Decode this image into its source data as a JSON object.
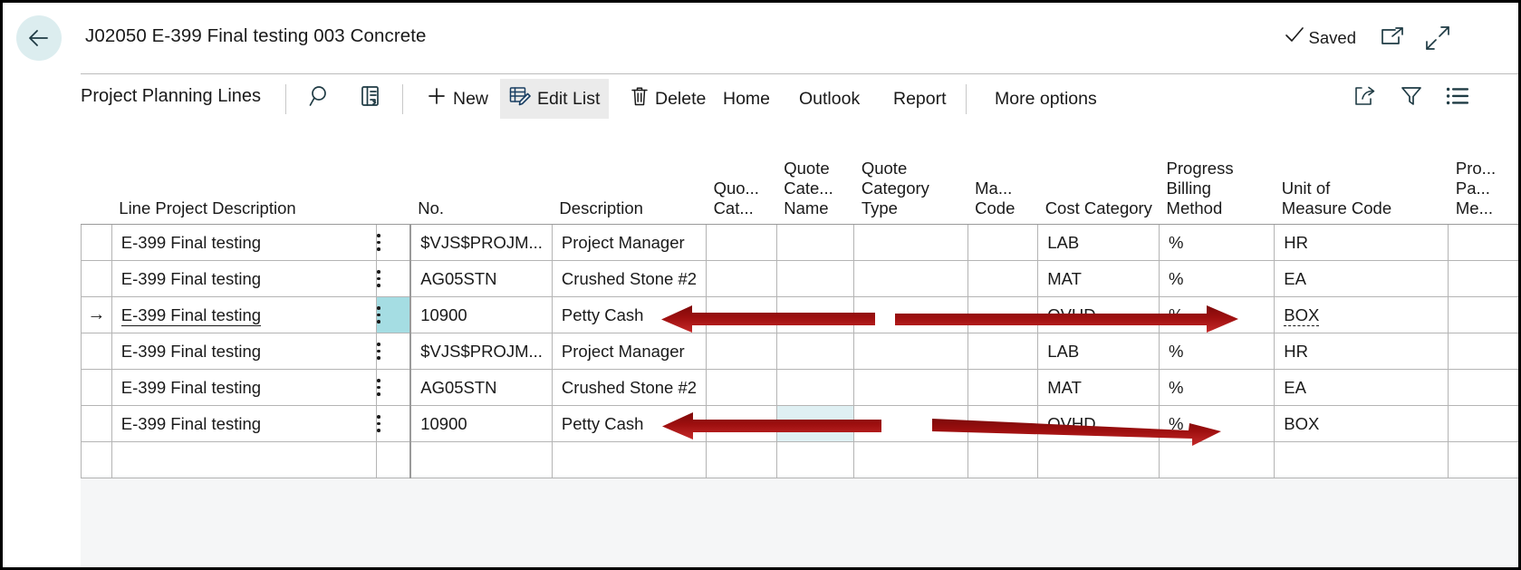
{
  "window": {
    "title": "J02050 E-399 Final testing 003 Concrete",
    "status": "Saved",
    "back_icon": "back-arrow-icon",
    "open_in_new_window_icon": "open-new-window-icon",
    "collapse_icon": "collapse-icon",
    "saved_check_icon": "check-icon"
  },
  "commandbar": {
    "title": "Project Planning Lines",
    "search_icon": "search-icon",
    "focus_icon": "focus-mode-icon",
    "new_label": "New",
    "new_icon": "plus-icon",
    "edit_list_label": "Edit List",
    "edit_list_icon": "edit-list-icon",
    "delete_label": "Delete",
    "delete_icon": "trash-icon",
    "home_label": "Home",
    "outlook_label": "Outlook",
    "report_label": "Report",
    "more_options_label": "More options",
    "share_icon": "share-icon",
    "filter_icon": "filter-icon",
    "list_icon": "list-view-icon"
  },
  "grid": {
    "columns": [
      {
        "id": "indicator",
        "header": ""
      },
      {
        "id": "line_project_description",
        "header": "Line Project Description"
      },
      {
        "id": "menu",
        "header": ""
      },
      {
        "id": "no",
        "header": "No."
      },
      {
        "id": "description",
        "header": "Description"
      },
      {
        "id": "quote_cat",
        "header": "Quo...\nCat..."
      },
      {
        "id": "quote_category_name",
        "header": "Quote\nCate...\nName"
      },
      {
        "id": "quote_category_type",
        "header": "Quote\nCategory\nType"
      },
      {
        "id": "ma_code",
        "header": "Ma...\nCode"
      },
      {
        "id": "cost_category",
        "header": "Cost Category"
      },
      {
        "id": "progress_billing_method",
        "header": "Progress\nBilling\nMethod"
      },
      {
        "id": "unit_of_measure_code",
        "header": "Unit of\nMeasure Code"
      },
      {
        "id": "progress_payment_method",
        "header": "Pro...\nPa...\nMe..."
      }
    ],
    "rows": [
      {
        "indicator": "",
        "line_project_description": "E-399 Final testing",
        "no": "$VJS$PROJM...",
        "description": "Project Manager",
        "quote_cat": "",
        "quote_category_name": "",
        "quote_category_type": "",
        "ma_code": "",
        "cost_category": "LAB",
        "progress_billing_method": "%",
        "unit_of_measure_code": "HR",
        "progress_payment_method": "",
        "selected": false
      },
      {
        "indicator": "",
        "line_project_description": "E-399 Final testing",
        "no": "AG05STN",
        "description": "Crushed Stone #2",
        "quote_cat": "",
        "quote_category_name": "",
        "quote_category_type": "",
        "ma_code": "",
        "cost_category": "MAT",
        "progress_billing_method": "%",
        "unit_of_measure_code": "EA",
        "progress_payment_method": "",
        "selected": false
      },
      {
        "indicator": "→",
        "line_project_description": "E-399 Final testing",
        "no": "10900",
        "description": "Petty Cash",
        "quote_cat": "",
        "quote_category_name": "",
        "quote_category_type": "",
        "ma_code": "",
        "cost_category": "OVHD",
        "progress_billing_method": "%",
        "unit_of_measure_code": "BOX",
        "progress_payment_method": "",
        "selected": true
      },
      {
        "indicator": "",
        "line_project_description": "E-399 Final testing",
        "no": "$VJS$PROJM...",
        "description": "Project Manager",
        "quote_cat": "",
        "quote_category_name": "",
        "quote_category_type": "",
        "ma_code": "",
        "cost_category": "LAB",
        "progress_billing_method": "%",
        "unit_of_measure_code": "HR",
        "progress_payment_method": "",
        "selected": false
      },
      {
        "indicator": "",
        "line_project_description": "E-399 Final testing",
        "no": "AG05STN",
        "description": "Crushed Stone #2",
        "quote_cat": "",
        "quote_category_name": "",
        "quote_category_type": "",
        "ma_code": "",
        "cost_category": "MAT",
        "progress_billing_method": "%",
        "unit_of_measure_code": "EA",
        "progress_payment_method": "",
        "selected": false
      },
      {
        "indicator": "",
        "line_project_description": "E-399 Final testing",
        "no": "10900",
        "description": "Petty Cash",
        "quote_cat": "",
        "quote_category_name": "",
        "quote_category_type": "",
        "ma_code": "",
        "cost_category": "OVHD",
        "progress_billing_method": "%",
        "unit_of_measure_code": "BOX",
        "progress_payment_method": "",
        "selected": false
      },
      {
        "indicator": "",
        "line_project_description": "",
        "no": "",
        "description": "",
        "quote_cat": "",
        "quote_category_name": "",
        "quote_category_type": "",
        "ma_code": "",
        "cost_category": "",
        "progress_billing_method": "",
        "unit_of_measure_code": "",
        "progress_payment_method": "",
        "selected": false
      }
    ]
  },
  "annotations": {
    "color": "#9e0f0f",
    "arrows": [
      {
        "name": "arrow-row3-left",
        "desc": "left-pointing arrow across Description/Quote columns on selected row"
      },
      {
        "name": "arrow-row3-right",
        "desc": "right-pointing arrow across Cost Category to Unit of Measure on selected row"
      },
      {
        "name": "arrow-row6-left",
        "desc": "left-pointing arrow across Description/Quote columns on last data row"
      },
      {
        "name": "arrow-row6-right",
        "desc": "right-pointing slanted arrow across Cost Category to Unit of Measure on last data row"
      }
    ]
  }
}
